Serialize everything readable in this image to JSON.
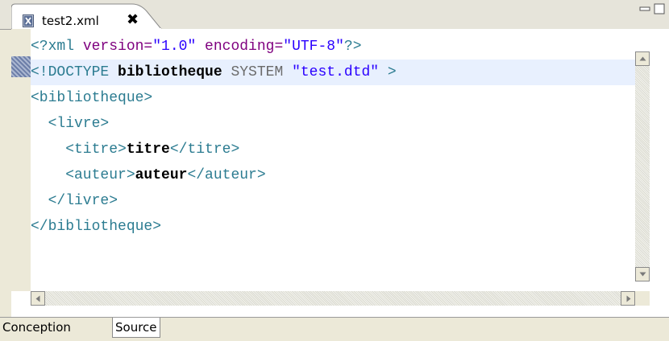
{
  "editor_tab": {
    "title": "test2.xml",
    "close_glyph": "✖",
    "icon": "xml-file-icon"
  },
  "window_controls": {
    "minimize_icon": "minimize-icon",
    "maximize_icon": "maximize-icon"
  },
  "code_lines": [
    {
      "tokens": [
        {
          "cls": "c-decl",
          "text": "<?xml "
        },
        {
          "cls": "c-attr",
          "text": "version="
        },
        {
          "cls": "c-val",
          "text": "\"1.0\""
        },
        {
          "cls": "c-attr",
          "text": " encoding="
        },
        {
          "cls": "c-val",
          "text": "\"UTF-8\""
        },
        {
          "cls": "c-decl",
          "text": "?>"
        }
      ]
    },
    {
      "tokens": [
        {
          "cls": "c-decl",
          "text": "<!DOCTYPE "
        },
        {
          "cls": "c-kw",
          "text": "bibliotheque"
        },
        {
          "cls": "c-sys",
          "text": " SYSTEM "
        },
        {
          "cls": "c-str",
          "text": "\"test.dtd\""
        },
        {
          "cls": "c-decl",
          "text": " >"
        }
      ]
    },
    {
      "tokens": [
        {
          "cls": "c-tag",
          "text": "<bibliotheque>"
        }
      ]
    },
    {
      "tokens": [
        {
          "cls": "c-tag",
          "text": "  <livre>"
        }
      ]
    },
    {
      "tokens": [
        {
          "cls": "c-tag",
          "text": "    <titre>"
        },
        {
          "cls": "c-text",
          "text": "titre"
        },
        {
          "cls": "c-tag",
          "text": "</titre>"
        }
      ]
    },
    {
      "tokens": [
        {
          "cls": "c-tag",
          "text": "    <auteur>"
        },
        {
          "cls": "c-text",
          "text": "auteur"
        },
        {
          "cls": "c-tag",
          "text": "</auteur>"
        }
      ]
    },
    {
      "tokens": [
        {
          "cls": "c-tag",
          "text": "  </livre>"
        }
      ]
    },
    {
      "tokens": [
        {
          "cls": "c-tag",
          "text": "</bibliotheque>"
        }
      ]
    }
  ],
  "highlighted_line": 1,
  "bottom_tabs": [
    {
      "label": "Conception",
      "active": false
    },
    {
      "label": "Source",
      "active": true
    }
  ]
}
